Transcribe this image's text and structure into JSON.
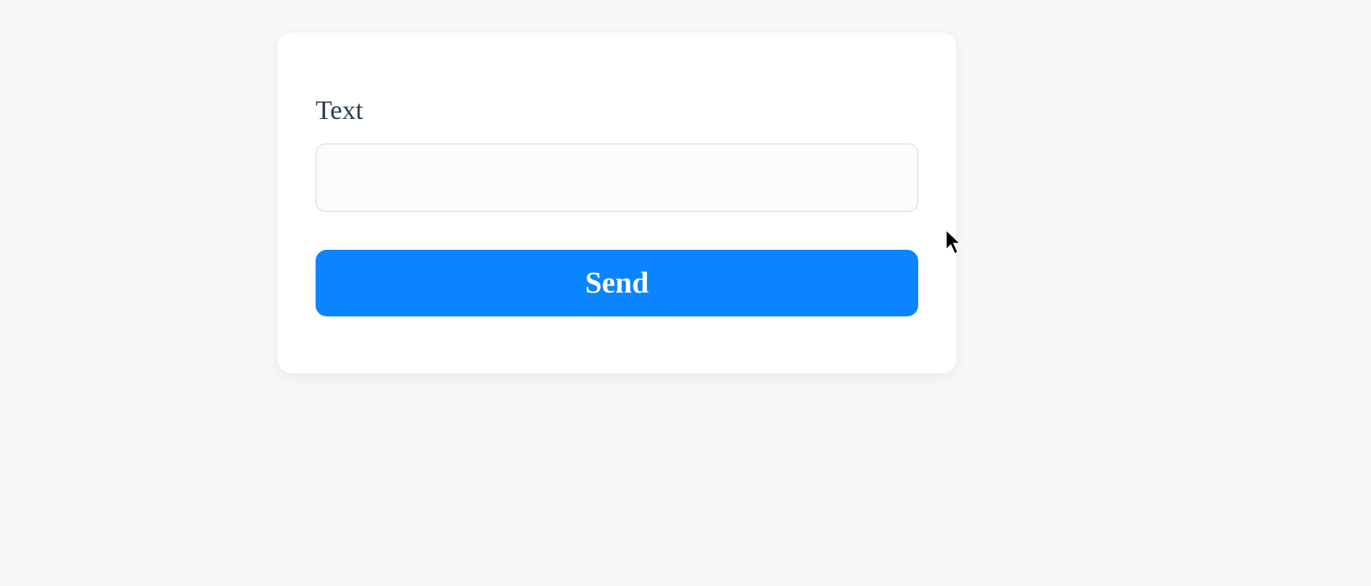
{
  "form": {
    "text_label": "Text",
    "text_value": "",
    "text_placeholder": "",
    "send_label": "Send"
  }
}
